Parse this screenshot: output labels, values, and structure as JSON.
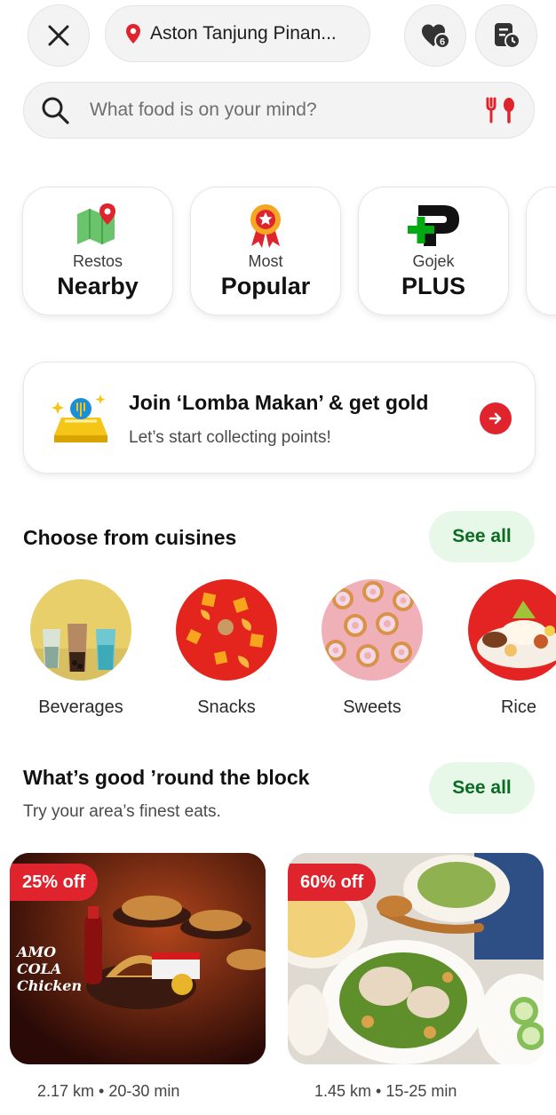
{
  "topbar": {
    "location_text": "Aston Tanjung Pinan...",
    "icons": [
      "close-icon",
      "location-pin-icon",
      "favorites-heart-icon",
      "order-history-icon"
    ]
  },
  "search": {
    "placeholder": "What food is on your mind?"
  },
  "quick_links": [
    {
      "small": "Restos",
      "big": "Nearby",
      "icon": "map-pin-icon"
    },
    {
      "small": "Most",
      "big": "Popular",
      "icon": "award-ribbon-icon"
    },
    {
      "small": "Gojek",
      "big": "PLUS",
      "icon": "gojek-plus-logo"
    }
  ],
  "promo": {
    "title": "Join ‘Lomba Makan’ & get gold",
    "subtitle": "Let’s start collecting points!"
  },
  "cuisines": {
    "title": "Choose from cuisines",
    "see_all": "See all",
    "items": [
      "Beverages",
      "Snacks",
      "Sweets",
      "Rice"
    ]
  },
  "nearby": {
    "title": "What’s good ’round the block",
    "subtitle": "Try your area’s finest eats.",
    "see_all": "See all",
    "restaurants": [
      {
        "discount": "25% off",
        "meta": "2.17 km • 20-30 min",
        "poster_text": "AMO COLA Chicken"
      },
      {
        "discount": "60% off",
        "meta": "1.45 km • 15-25 min"
      }
    ]
  },
  "colors": {
    "accent_red": "#e0242e",
    "accent_green": "#00aa13",
    "see_all_bg": "#e7f8e9"
  }
}
